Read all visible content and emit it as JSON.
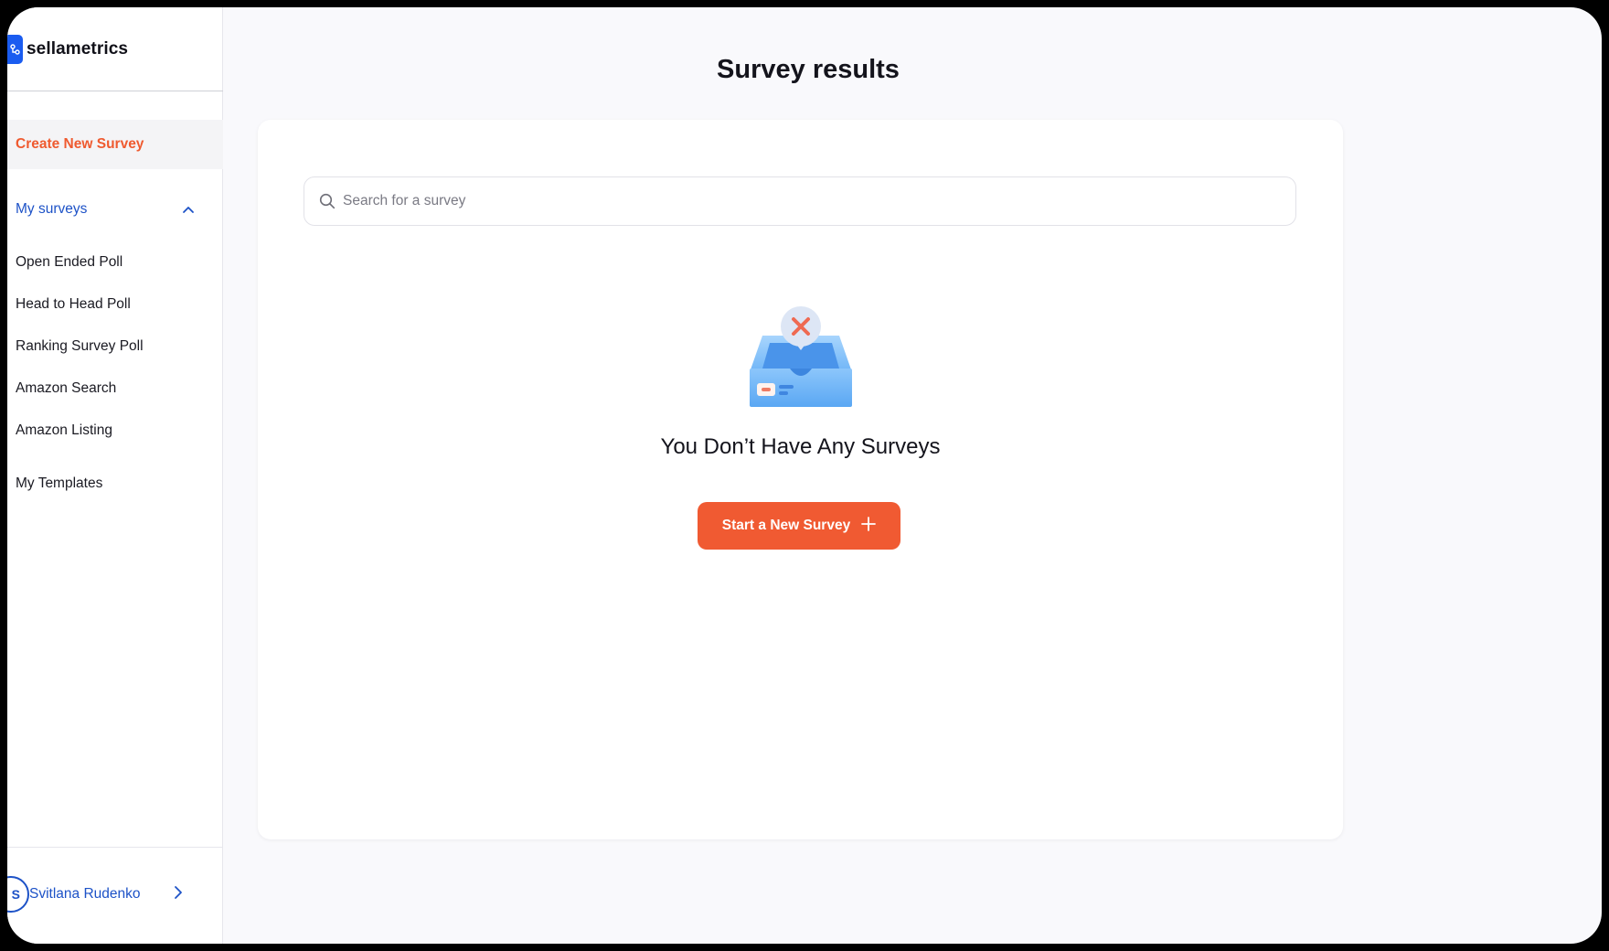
{
  "brand": {
    "name": "sellametrics",
    "logo_icon": "sellametrics-logo-icon",
    "accent": "#1a5cf0"
  },
  "sidebar": {
    "create_label": "Create New Survey",
    "my_surveys_label": "My surveys",
    "sub_items": [
      {
        "label": "Open Ended Poll"
      },
      {
        "label": "Head to Head Poll"
      },
      {
        "label": "Ranking Survey Poll"
      },
      {
        "label": "Amazon Search"
      },
      {
        "label": "Amazon Listing"
      }
    ],
    "templates_label": "My Templates",
    "user": {
      "name": "Svitlana Rudenko",
      "initial": "S"
    }
  },
  "main": {
    "title": "Survey results",
    "search": {
      "placeholder": "Search for a survey",
      "value": ""
    },
    "empty_state": {
      "icon": "empty-inbox-icon",
      "title": "You Don’t Have Any Surveys",
      "button_label": "Start a New Survey",
      "button_icon": "plus-icon"
    }
  },
  "colors": {
    "primary_orange": "#f05a32",
    "link_blue": "#1d52c7",
    "background": "#f9f9fc"
  }
}
